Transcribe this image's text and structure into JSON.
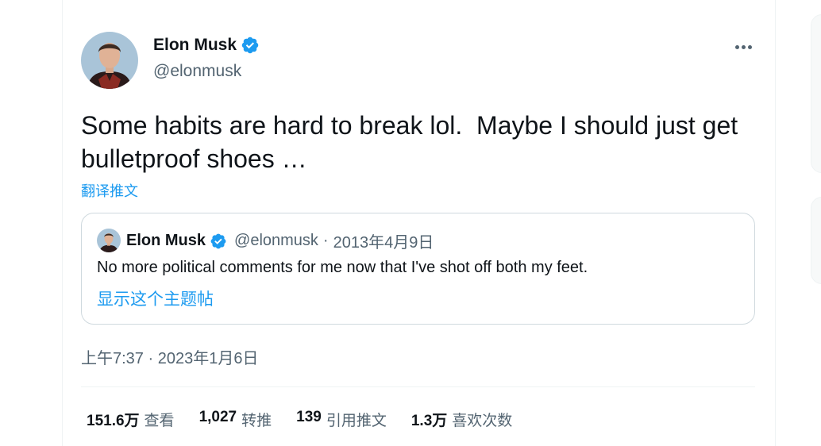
{
  "tweet": {
    "author": {
      "name": "Elon Musk",
      "handle": "@elonmusk"
    },
    "text": "Some habits are hard to break lol.  Maybe I should just get bulletproof shoes …",
    "translate_label": "翻译推文",
    "timestamp": "上午7:37 · 2023年1月6日",
    "quoted": {
      "name": "Elon Musk",
      "handle": "@elonmusk",
      "separator": "·",
      "date": "2013年4月9日",
      "text": "No more political comments for me now that I've shot off both my feet.",
      "show_thread_label": "显示这个主题帖"
    },
    "stats": [
      {
        "value": "151.6万",
        "label": "查看"
      },
      {
        "value": "1,027",
        "label": "转推"
      },
      {
        "value": "139",
        "label": "引用推文"
      },
      {
        "value": "1.3万",
        "label": "喜欢次数"
      }
    ]
  },
  "icons": {
    "verified": "verified-badge-icon",
    "more": "more-horizontal-icon"
  },
  "colors": {
    "accent": "#1d9bf0",
    "text_primary": "#0f1419",
    "text_secondary": "#536471",
    "border": "#cfd9de"
  }
}
